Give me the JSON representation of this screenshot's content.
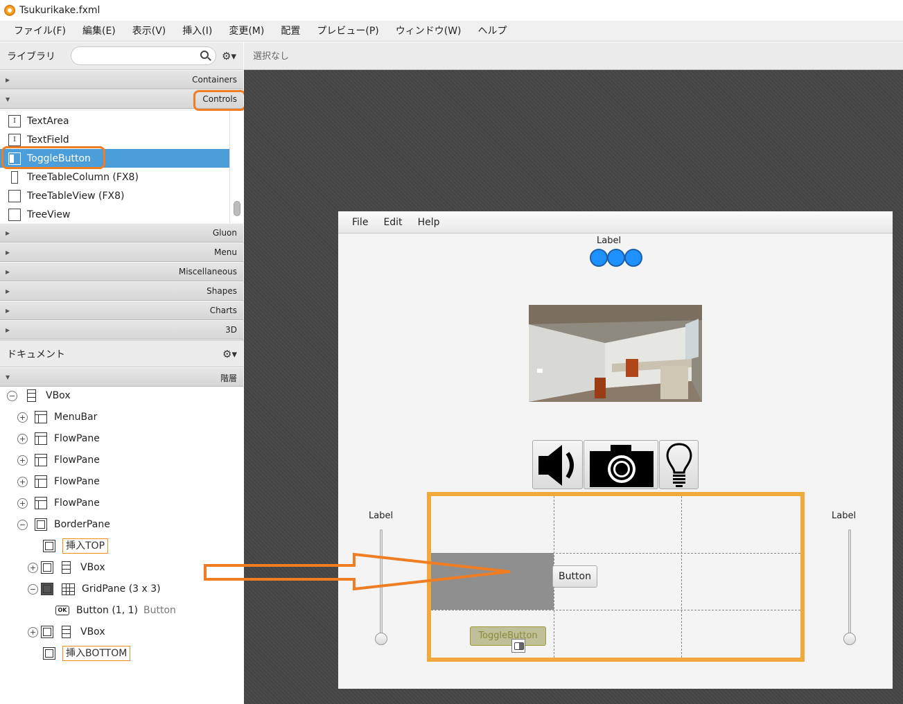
{
  "window": {
    "title": "Tsukurikake.fxml"
  },
  "menubar": [
    "ファイル(F)",
    "編集(E)",
    "表示(V)",
    "挿入(I)",
    "変更(M)",
    "配置",
    "プレビュー(P)",
    "ウィンドウ(W)",
    "ヘルプ"
  ],
  "library": {
    "title": "ライブラリ",
    "search_placeholder": "",
    "sections_top": [
      "Containers",
      "Controls"
    ],
    "items": [
      {
        "label": "TextArea",
        "icon": "text-area-icon",
        "glyph": "I"
      },
      {
        "label": "TextField",
        "icon": "text-field-icon",
        "glyph": "I"
      },
      {
        "label": "ToggleButton",
        "icon": "toggle-button-icon",
        "glyph": "",
        "selected": true
      },
      {
        "label": "TreeTableColumn   (FX8)",
        "icon": "tree-table-column-icon",
        "glyph": ""
      },
      {
        "label": "TreeTableView   (FX8)",
        "icon": "tree-table-view-icon",
        "glyph": ""
      },
      {
        "label": "TreeView",
        "icon": "tree-view-icon",
        "glyph": ""
      }
    ],
    "sections_bottom": [
      "Gluon",
      "Menu",
      "Miscellaneous",
      "Shapes",
      "Charts",
      "3D"
    ]
  },
  "document": {
    "title": "ドキュメント",
    "hierarchy_label": "階層",
    "tree": [
      {
        "label": "VBox",
        "toggle": "−",
        "icon": "vbox"
      },
      {
        "label": "MenuBar",
        "toggle": "+",
        "icon": "pane"
      },
      {
        "label": "FlowPane",
        "toggle": "+",
        "icon": "pane"
      },
      {
        "label": "FlowPane",
        "toggle": "+",
        "icon": "pane"
      },
      {
        "label": "FlowPane",
        "toggle": "+",
        "icon": "pane"
      },
      {
        "label": "FlowPane",
        "toggle": "+",
        "icon": "pane"
      },
      {
        "label": "BorderPane",
        "toggle": "−",
        "icon": "border"
      },
      {
        "label": "挿入TOP",
        "toggle": "",
        "icon": "border",
        "slot": true
      },
      {
        "label": "VBox",
        "toggle": "+",
        "icon": "vbox"
      },
      {
        "label": "GridPane (3 x 3)",
        "toggle": "−",
        "icon": "grid"
      },
      {
        "label": "Button (1, 1)",
        "toggle": "",
        "icon": "ok",
        "secondary": "Button"
      },
      {
        "label": "VBox",
        "toggle": "+",
        "icon": "vbox"
      },
      {
        "label": "挿入BOTTOM",
        "toggle": "",
        "icon": "border",
        "slot": true
      }
    ]
  },
  "status": {
    "selection": "選択なし"
  },
  "preview": {
    "menu": [
      "File",
      "Edit",
      "Help"
    ],
    "top_label": "Label",
    "left_label": "Label",
    "right_label": "Label",
    "ghost_button": "ToggleButton",
    "grid_button": "Button",
    "toolbar_icons": [
      "speaker-icon",
      "camera-icon",
      "lightbulb-icon"
    ],
    "highlight_color": "#f0a93a",
    "annotation_color": "#f07d22",
    "selection_color": "#4b9ed9"
  }
}
